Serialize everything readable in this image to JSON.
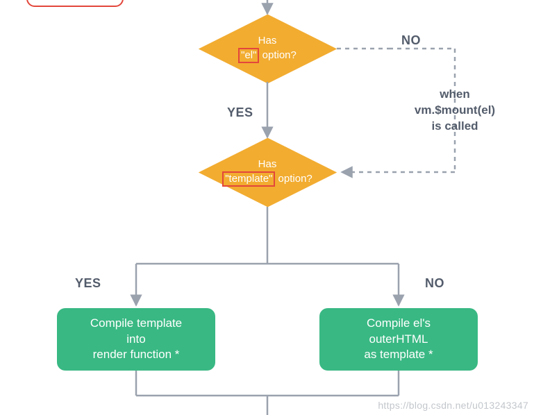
{
  "decision_el": {
    "line1": "Has",
    "quoted": "\"el\"",
    "after_quoted": " option?"
  },
  "decision_template": {
    "line1": "Has",
    "quoted": "\"template\"",
    "after_quoted": " option?"
  },
  "labels": {
    "el_yes": "YES",
    "el_no": "NO",
    "tpl_yes": "YES",
    "tpl_no": "NO"
  },
  "side_note": {
    "l1": "when",
    "l2": "vm.$mount(el)",
    "l3": "is called"
  },
  "term_left": {
    "l1": "Compile template",
    "l2": "into",
    "l3": "render function *"
  },
  "term_right": {
    "l1": "Compile el's",
    "l2": "outerHTML",
    "l3": "as template *"
  },
  "watermark": "https://blog.csdn.net/u013243347",
  "colors": {
    "diamond": "#f2ac30",
    "terminal": "#39b883",
    "highlight_border": "#e3463b",
    "text": "#535c6b",
    "edge": "#9aa2ae"
  }
}
